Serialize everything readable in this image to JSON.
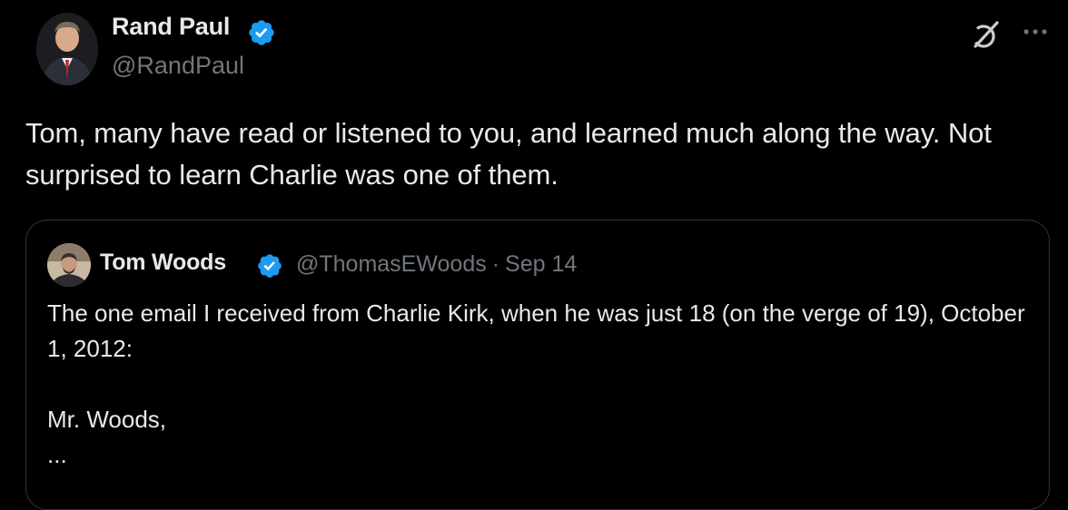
{
  "post": {
    "author_name": "Rand Paul",
    "author_handle": "@RandPaul",
    "text": "Tom, many have read or listened to you, and learned much along the way.  Not surprised to learn Charlie was one of them."
  },
  "quote": {
    "author_name": "Tom Woods",
    "author_handle": "@ThomasEWoods",
    "separator": "·",
    "date": "Sep 14",
    "text": "The one email I received from Charlie Kirk, when he was just 18 (on the verge of 19), October 1, 2012:\n\nMr. Woods,\n..."
  },
  "icons": {
    "verified": "verified-badge-icon",
    "grok": "grok-icon",
    "more": "more-options-icon"
  },
  "colors": {
    "background": "#000000",
    "text_primary": "#e7e9ea",
    "text_secondary": "#71767b",
    "verified": "#1d9bf0",
    "border": "#2f3336"
  }
}
